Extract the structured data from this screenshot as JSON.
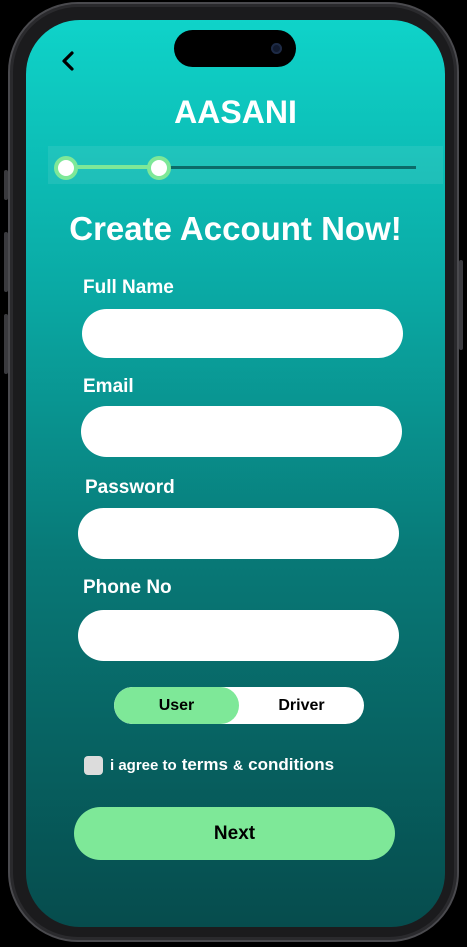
{
  "header": {
    "back_icon": "chevron-left-icon",
    "app_title": "AASANI"
  },
  "progress": {
    "current_step": 2,
    "fill_fraction": 0.27,
    "active_color": "#7ee898"
  },
  "form": {
    "heading": "Create Account Now!",
    "fields": [
      {
        "label": "Full Name",
        "value": ""
      },
      {
        "label": "Email",
        "value": ""
      },
      {
        "label": "Password",
        "value": ""
      },
      {
        "label": "Phone No",
        "value": ""
      }
    ],
    "role_toggle": {
      "options": [
        "User",
        "Driver"
      ],
      "selected": "User"
    },
    "agree": {
      "prefix": "i agree to",
      "terms": "terms",
      "amp": "&",
      "conditions": "conditions"
    },
    "next_label": "Next"
  },
  "colors": {
    "accent_green": "#7ee898",
    "gradient_top": "#0fd3c9",
    "gradient_bottom": "#064c4d"
  }
}
